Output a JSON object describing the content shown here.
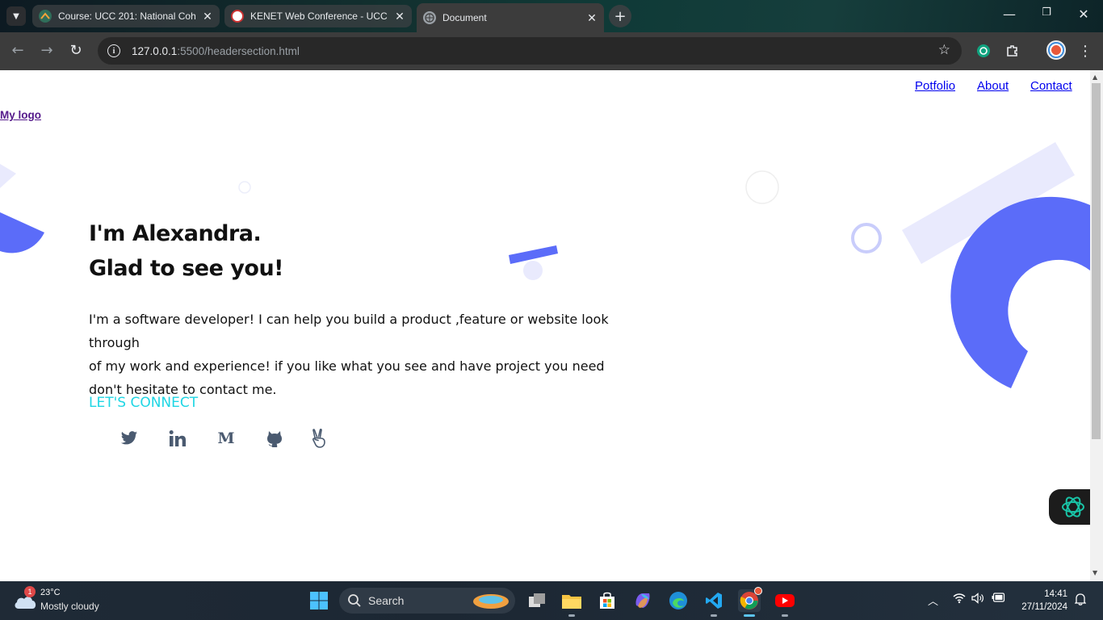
{
  "browser": {
    "tabs": [
      {
        "title": "Course: UCC 201: National Coh",
        "active": false
      },
      {
        "title": "KENET Web Conference - UCC",
        "active": false
      },
      {
        "title": "Document",
        "active": true
      }
    ],
    "url_host": "127.0.0.1",
    "url_path": ":5500/headersection.html"
  },
  "page": {
    "nav": {
      "portfolio": "Potfolio",
      "about": "About",
      "contact": "Contact"
    },
    "logo": "My logo",
    "hero": {
      "line1": "I'm Alexandra.",
      "line2": "Glad to see you!",
      "paragraph_line1": "I'm a software developer! I can help you build a product ,feature or website look through",
      "paragraph_line2": "of my work and experience! if you like what you see and have project you need",
      "paragraph_line3": "don't hesitate to contact me.",
      "cta": "LET'S CONNECT"
    },
    "socials": [
      "twitter-icon",
      "linkedin-icon",
      "medium-icon",
      "github-icon",
      "angellist-icon"
    ],
    "colors": {
      "accent": "#5b6cf9",
      "accent_light": "#e9eafd",
      "connect": "#1ed6e4",
      "icon": "#4a5a70"
    }
  },
  "taskbar": {
    "weather_temp": "23°C",
    "weather_desc": "Mostly cloudy",
    "weather_badge": "1",
    "search_label": "Search",
    "time": "14:41",
    "date": "27/11/2024"
  }
}
